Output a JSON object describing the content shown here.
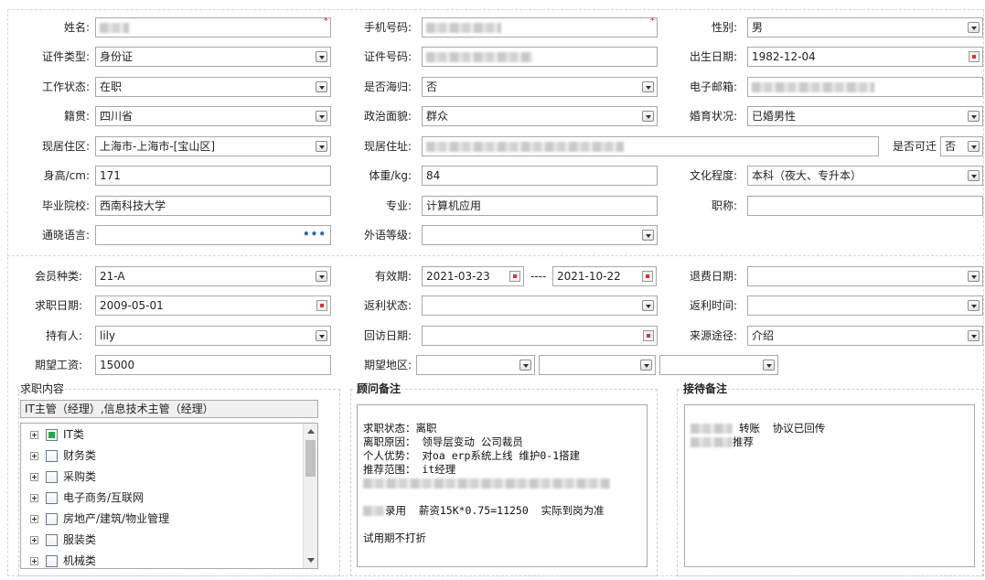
{
  "basic": {
    "name_label": "姓名:",
    "phone_label": "手机号码:",
    "gender_label": "性别:",
    "gender_value": "男",
    "idtype_label": "证件类型:",
    "idtype_value": "身份证",
    "idno_label": "证件号码:",
    "birth_label": "出生日期:",
    "birth_value": "1982-12-04",
    "workstatus_label": "工作状态:",
    "workstatus_value": "在职",
    "returnee_label": "是否海归:",
    "returnee_value": "否",
    "email_label": "电子邮箱:",
    "native_label": "籍贯:",
    "native_value": "四川省",
    "political_label": "政治面貌:",
    "political_value": "群众",
    "marital_label": "婚育状况:",
    "marital_value": "已婚男性",
    "residence_label": "现居住区:",
    "residence_value": "上海市-上海市-[宝山区]",
    "address_label": "现居住址:",
    "relocate_label": "是否可迁",
    "relocate_value": "否",
    "height_label": "身高/cm:",
    "height_value": "171",
    "weight_label": "体重/kg:",
    "weight_value": "84",
    "education_label": "文化程度:",
    "education_value": "本科（夜大、专升本）",
    "school_label": "毕业院校:",
    "school_value": "西南科技大学",
    "major_label": "专业:",
    "major_value": "计算机应用",
    "title_label": "职称:",
    "title_value": "",
    "language_label": "通晓语言:",
    "foreign_level_label": "外语等级:"
  },
  "member": {
    "type_label": "会员种类:",
    "type_value": "21-A",
    "validity_label": "有效期:",
    "validity_start": "2021-03-23",
    "validity_sep": "----",
    "validity_end": "2021-10-22",
    "refund_date_label": "退费日期:",
    "jobhunt_date_label": "求职日期:",
    "jobhunt_date_value": "2009-05-01",
    "rebate_status_label": "返利状态:",
    "rebate_time_label": "返利时间:",
    "holder_label": "持有人:",
    "holder_value": "lily",
    "revisit_label": "回访日期:",
    "source_label": "来源途径:",
    "source_value": "介绍",
    "salary_label": "期望工资:",
    "salary_value": "15000",
    "region_label": "期望地区:"
  },
  "jobs": {
    "title": "求职内容",
    "selected": "IT主管（经理）,信息技术主管（经理）",
    "tree": [
      {
        "label": "IT类",
        "state": "partial"
      },
      {
        "label": "财务类",
        "state": "unchecked"
      },
      {
        "label": "采购类",
        "state": "unchecked"
      },
      {
        "label": "电子商务/互联网",
        "state": "unchecked"
      },
      {
        "label": "房地产/建筑/物业管理",
        "state": "unchecked"
      },
      {
        "label": "服装类",
        "state": "unchecked"
      },
      {
        "label": "机械类",
        "state": "unchecked"
      }
    ]
  },
  "advisor_notes": {
    "title": "顾问备注",
    "line1": "求职状态：离职",
    "line2": "离职原因： 领导层变动 公司裁员",
    "line3": "个人优势： 对oa erp系统上线 维护0-1搭建",
    "line4": "推荐范围： it经理",
    "line6": "录用  薪资15K*0.75=11250  实际到岗为准",
    "line8": "试用期不打折"
  },
  "reception_notes": {
    "title": "接待备注",
    "line1": "转账  协议已回传",
    "line2": "推荐"
  }
}
